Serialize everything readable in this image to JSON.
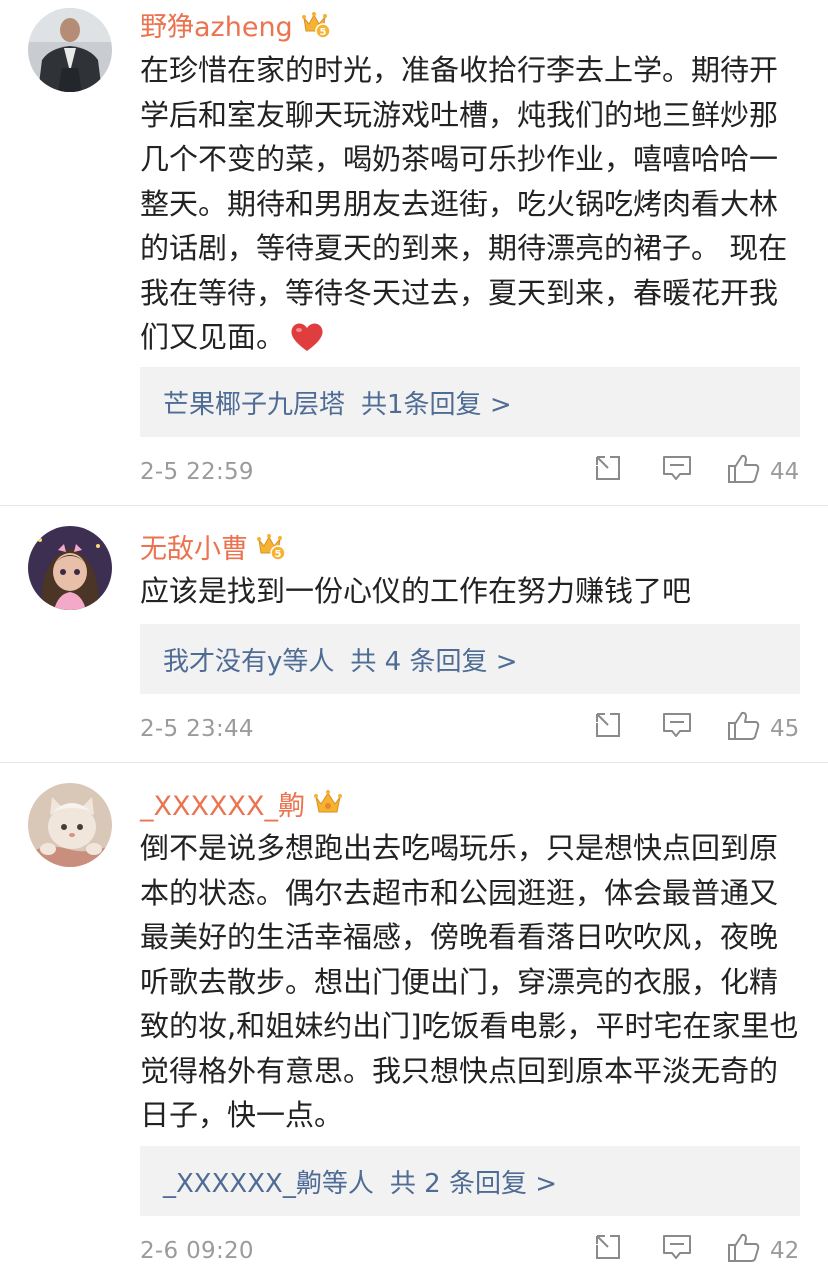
{
  "comments": [
    {
      "username": "野狰azheng",
      "text": "在珍惜在家的时光，准备收拾行李去上学。期待开学后和室友聊天玩游戏吐槽，炖我们的地三鲜炒那几个不变的菜，喝奶茶喝可乐抄作业，嘻嘻哈哈一整天。期待和男朋友去逛街，吃火锅吃烤肉看大林的话剧，等待夏天的到来，期待漂亮的裙子。 现在我在等待，等待冬天过去，夏天到来，春暖花开我们又见面。",
      "reply_user": "芒果椰子九层塔",
      "reply_count": "共1条回复 >",
      "timestamp": "2-5 22:59",
      "likes": "44",
      "badge_level": "5"
    },
    {
      "username": "无敌小曹",
      "text": "应该是找到一份心仪的工作在努力赚钱了吧",
      "reply_user": "我才没有y等人",
      "reply_count": "共 4 条回复 >",
      "timestamp": "2-5 23:44",
      "likes": "45",
      "badge_level": "5"
    },
    {
      "username": "_XXXXXX_齁",
      "text": "倒不是说多想跑出去吃喝玩乐，只是想快点回到原本的状态。偶尔去超市和公园逛逛，体会最普通又最美好的生活幸福感，傍晚看看落日吹吹风，夜晚听歌去散步。想出门便出门，穿漂亮的衣服，化精致的妆,和姐妹约出门]吃饭看电影，平时宅在家里也觉得格外有意思。我只想快点回到原本平淡无奇的日子，快一点。",
      "reply_user": "_XXXXXX_齁等人",
      "reply_count": "共 2 条回复 >",
      "timestamp": "2-6 09:20",
      "likes": "42"
    }
  ],
  "colors": {
    "username": "#eb7350",
    "reply_link": "#4f6c95",
    "meta_gray": "#9b9b9b",
    "reply_bg": "#f2f2f2",
    "badge_gold": "#f5b331",
    "heart": "#e03e3e"
  },
  "icons": [
    "vip-crown-icon",
    "heart-emoji-icon",
    "forward-icon",
    "comment-icon",
    "like-icon"
  ]
}
